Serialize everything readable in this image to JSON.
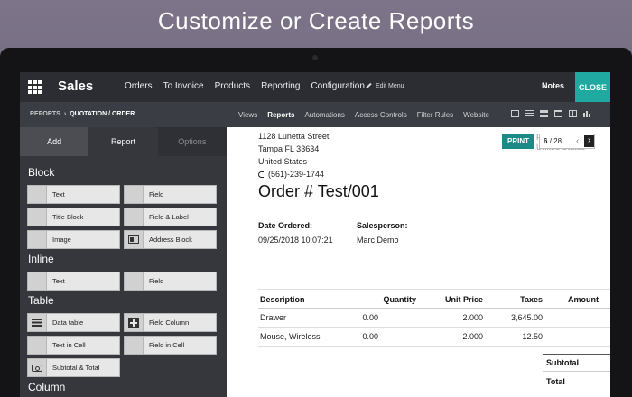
{
  "headline": "Customize or Create Reports",
  "topnav": {
    "brand": "Sales",
    "menu": [
      "Orders",
      "To Invoice",
      "Products",
      "Reporting",
      "Configuration"
    ],
    "edit_menu": "Edit Menu",
    "notes": "Notes",
    "close": "CLOSE"
  },
  "subbar": {
    "breadcrumb": [
      "REPORTS",
      "QUOTATION / ORDER"
    ],
    "breadcrumb_sep": "›",
    "menu": [
      "Views",
      "Reports",
      "Automations",
      "Access Controls",
      "Filter Rules",
      "Website"
    ],
    "active": "Reports",
    "view_icons": [
      "form-view-icon",
      "list-view-icon",
      "kanban-view-icon",
      "calendar-view-icon",
      "pivot-view-icon",
      "graph-view-icon"
    ]
  },
  "panel": {
    "tabs": [
      "Add",
      "Report",
      "Options"
    ],
    "sections": {
      "block": "Block",
      "inline": "Inline",
      "table": "Table",
      "column": "Column"
    },
    "block_items": [
      "Text",
      "Field",
      "Title Block",
      "Field & Label",
      "Image",
      "Address Block"
    ],
    "inline_items": [
      "Text",
      "Field"
    ],
    "table_items": [
      "Data table",
      "Field Column",
      "Text in Cell",
      "Field in Cell",
      "Subtotal & Total"
    ]
  },
  "doc": {
    "address": [
      "1128 Lunetta Street",
      "Tampa FL 33634",
      "United States"
    ],
    "phone": "(561)-239-1744",
    "ghost": [
      "F",
      "United States"
    ],
    "print": "PRINT",
    "pager_current": "6",
    "pager_total": "/ 28",
    "order_title": "Order # Test/001",
    "date_label": "Date Ordered:",
    "date_value": "09/25/2018 10:07:21",
    "sales_label": "Salesperson:",
    "sales_value": "Marc Demo",
    "headers": [
      "Description",
      "Quantity",
      "Unit Price",
      "Taxes",
      "Amount"
    ],
    "rows": [
      {
        "desc": "Drawer",
        "qty": "0.00",
        "price": "2.000",
        "taxes": "3,645.00"
      },
      {
        "desc": "Mouse, Wireless",
        "qty": "0.00",
        "price": "2.000",
        "taxes": "12.50"
      }
    ],
    "subtotal": "Subtotal",
    "total": "Total"
  }
}
